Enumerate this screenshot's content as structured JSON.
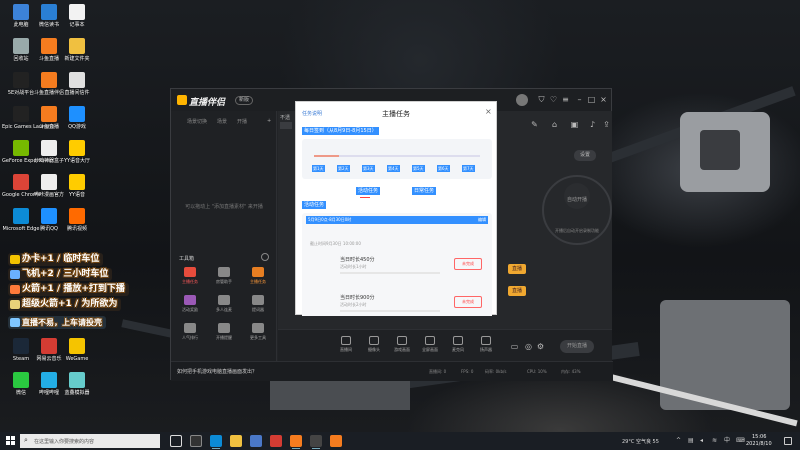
{
  "desktop": {
    "icons": [
      {
        "label": "此电脑",
        "color": "#3c82d8"
      },
      {
        "label": "微信读书",
        "color": "#2a7fd4"
      },
      {
        "label": "记事本",
        "color": "#f2f2f2"
      },
      {
        "label": "回收站",
        "color": "#9aa"
      },
      {
        "label": "斗鱼直播",
        "color": "#f57c1f"
      },
      {
        "label": "新建文件夹",
        "color": "#f0c040"
      },
      {
        "label": "5E对战平台",
        "color": "#222"
      },
      {
        "label": "斗鱼直播伴侣",
        "color": "#f57c1f"
      },
      {
        "label": "直播间信件",
        "color": "#e0e0e0"
      },
      {
        "label": "Epic Games Launcher",
        "color": "#222"
      },
      {
        "label": "斗鱼直播",
        "color": "#f57c1f"
      },
      {
        "label": "QQ游戏",
        "color": "#1e90ff"
      },
      {
        "label": "GeForce Experience",
        "color": "#76b900"
      },
      {
        "label": "炒鸡神器盒子",
        "color": "#eee"
      },
      {
        "label": "YY语音大厅",
        "color": "#ffcc00"
      },
      {
        "label": "Google Chrome",
        "color": "#db4437"
      },
      {
        "label": "哔咔漫画官方",
        "color": "#eee"
      },
      {
        "label": "YY语音",
        "color": "#ffcc00"
      },
      {
        "label": "Microsoft Edge",
        "color": "#0c8bd6"
      },
      {
        "label": "腾讯QQ",
        "color": "#1e90ff"
      },
      {
        "label": "腾讯视频",
        "color": "#ff6a00"
      },
      {
        "label": "Steam",
        "color": "#1b2838"
      },
      {
        "label": "网易云音乐",
        "color": "#d43c33"
      },
      {
        "label": "WeGame",
        "color": "#f5c400"
      },
      {
        "label": "微信",
        "color": "#2ac940"
      },
      {
        "label": "哔哩哔哩",
        "color": "#23ade5"
      },
      {
        "label": "蓝叠模拟器",
        "color": "#6cc"
      }
    ]
  },
  "stickers": [
    "办卡+1 / 临时车位",
    "飞机+2 / 三小时车位",
    "火箭+1 / 播放+打到下播",
    "超级火箭+1 / 为所欲为",
    "直播不易，上车请投壳"
  ],
  "app": {
    "logo_text": "直播伴侣",
    "version": "新版",
    "tabs": [
      "场景切换",
      "场景",
      "开播"
    ],
    "scene_empty": "可以拖动上 \"添加直播素材\" 来开播",
    "tools_title": "工具箱",
    "tools": [
      {
        "label": "主播任务",
        "color": "#e74c3c"
      },
      {
        "label": "房管助手",
        "color": "#888"
      },
      {
        "label": "主播任务",
        "color": "#e67e22"
      },
      {
        "label": "活动奖励",
        "color": "#9b59b6"
      },
      {
        "label": "多人连麦",
        "color": "#888"
      },
      {
        "label": "提词器",
        "color": "#888"
      },
      {
        "label": "人气排行",
        "color": "#888"
      },
      {
        "label": "开播提醒",
        "color": "#888"
      },
      {
        "label": "更多工具",
        "color": "#888"
      }
    ],
    "bottom_buttons": [
      "直播间",
      "摄像头",
      "游戏画面",
      "全屏画面",
      "麦克风",
      "扬声器"
    ],
    "start_live": "开始直播",
    "auto_label": "自动开播",
    "auto_desc": "开播后自动开启录制功能",
    "pill_label": "设置",
    "orange_tags": [
      "直播",
      "直播"
    ],
    "status_notice": "如何把手机游戏电脑直播画面发出？",
    "status_items": [
      "直播间: 0",
      "FPS: 0",
      "码率: 0kb/s",
      "CPU: 10%",
      "内存: 43%"
    ]
  },
  "dialog": {
    "title": "主播任务",
    "rules_link": "任务说明",
    "close": "×",
    "checkin_header": "每日签到（从8月9日-8月15日）",
    "checkin_progress": 0.15,
    "days": [
      "第1天",
      "第2天",
      "第3天",
      "第4天",
      "第5天",
      "第6天",
      "第7天"
    ],
    "tabs": [
      "活动任务",
      "日常任务"
    ],
    "tasks_title": "活动任务",
    "task_period": "5月9日0点-8月30日0时",
    "task_edit": "编辑",
    "task_deadline": "截止时间9月30日 10:00:00",
    "tasks": [
      {
        "title": "当日时长450分",
        "sub": "活动时长1小时",
        "button": "未完成"
      },
      {
        "title": "当日时长900分",
        "sub": "活动时长2小时",
        "button": "未完成"
      }
    ]
  },
  "taskbar": {
    "search_placeholder": "在这里输入你要搜索的内容",
    "weather": "29°C 空气良 55",
    "time": "15:06",
    "date": "2021/8/10"
  }
}
